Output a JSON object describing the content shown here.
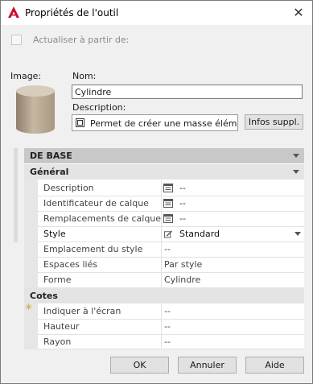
{
  "window": {
    "title": "Propriétés de l'outil",
    "close_glyph": "✕"
  },
  "refresh_label": "Actualiser à partir de:",
  "image_label": "Image:",
  "name": {
    "label": "Nom:",
    "value": "Cylindre"
  },
  "description": {
    "label": "Description:",
    "value": "Permet de créer une masse élémen"
  },
  "info_button": "Infos suppl.",
  "property_grid": {
    "category_base": "DE BASE",
    "general": {
      "title": "Général",
      "rows": [
        {
          "key": "Description",
          "value": "--"
        },
        {
          "key": "Identificateur de calque",
          "value": "--"
        },
        {
          "key": "Remplacements de calque",
          "value": "--"
        },
        {
          "key": "Style",
          "value": "Standard"
        },
        {
          "key": "Emplacement du style",
          "value": "--"
        },
        {
          "key": "Espaces liés",
          "value": "Par style"
        },
        {
          "key": "Forme",
          "value": "Cylindre"
        }
      ]
    },
    "cotes": {
      "title": "Cotes",
      "rows": [
        {
          "key": "Indiquer à l'écran",
          "value": "--"
        },
        {
          "key": "Hauteur",
          "value": "--"
        },
        {
          "key": "Rayon",
          "value": "--"
        }
      ]
    }
  },
  "buttons": {
    "ok": "OK",
    "cancel": "Annuler",
    "help": "Aide"
  },
  "colors": {
    "app_red": "#c8102e",
    "category_bg": "#c8c8c8"
  }
}
